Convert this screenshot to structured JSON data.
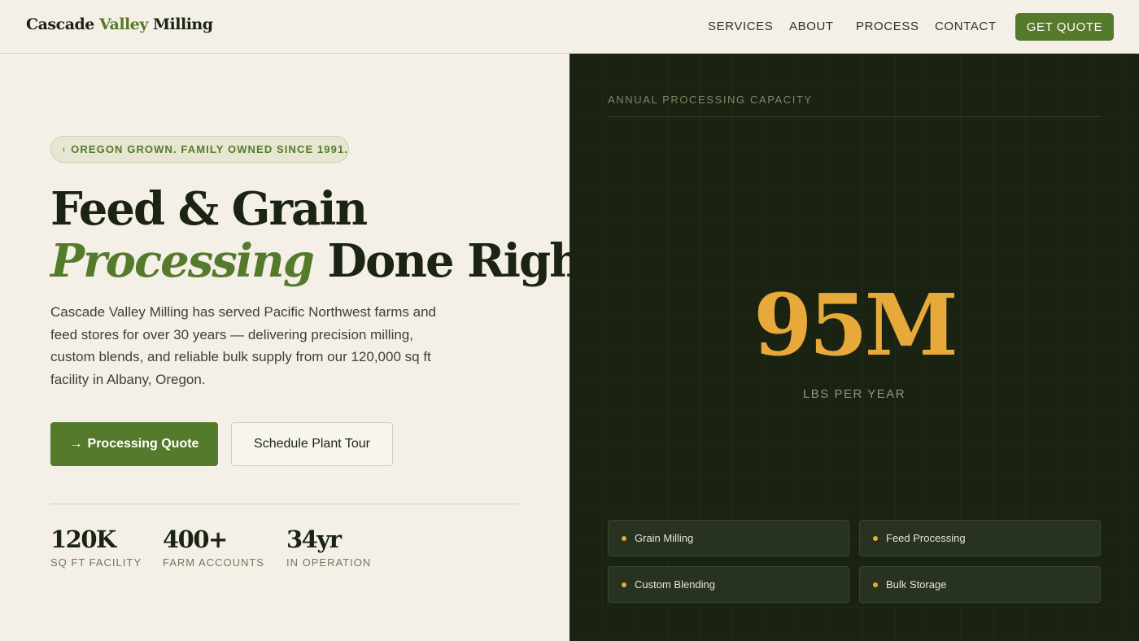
{
  "header": {
    "logo": {
      "part1": "Cascade",
      "accent": "Valley",
      "part2": "Milling"
    },
    "nav": [
      "SERVICES",
      "ABOUT",
      "PROCESS",
      "CONTACT"
    ],
    "cta": "GET QUOTE"
  },
  "hero": {
    "badge": "OREGON GROWN. FAMILY OWNED SINCE 1991.",
    "title_line1": "Feed & Grain",
    "title_line2_italic": "Processing",
    "title_line2_rest": "Done Right",
    "description": "Cascade Valley Milling has served Pacific Northwest farms and feed stores for over 30 years — delivering precision milling, custom blends, and reliable bulk supply from our 120,000 sq ft facility in Albany, Oregon.",
    "primary_button": {
      "icon": "→",
      "label": "Processing Quote"
    },
    "secondary_button": "Schedule Plant Tour",
    "stats": [
      {
        "value": "120K",
        "label": "SQ FT FACILITY"
      },
      {
        "value": "400+",
        "label": "FARM ACCOUNTS"
      },
      {
        "value": "34yr",
        "label": "IN OPERATION"
      }
    ]
  },
  "capacity": {
    "title": "ANNUAL PROCESSING CAPACITY",
    "value": "95M",
    "unit": "LBS PER YEAR",
    "services": [
      "Grain Milling",
      "Feed Processing",
      "Custom Blending",
      "Bulk Storage"
    ]
  },
  "colors": {
    "brand_green": "#567a2b",
    "dark_panel": "#1a2311",
    "accent_gold": "#e8a93b",
    "cream": "#f4f0e7"
  }
}
